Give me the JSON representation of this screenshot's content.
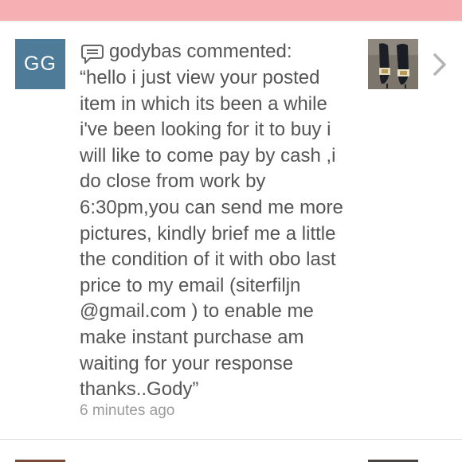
{
  "notification": {
    "avatar_initials": "GG",
    "username": "godybas",
    "action": "commented:",
    "comment_lines": [
      "“hello i just view your posted",
      "item in which its been a while",
      "i've been looking for it to buy i",
      "will like to come pay by cash ,i",
      "do close from work by",
      "6:30pm,you can send me more",
      "pictures, kindly brief me a little",
      "the condition of it with obo last",
      "price to my email (siterfiljn",
      "@gmail.com ) to enable me",
      "make instant purchase am",
      "waiting for your response",
      "thanks..Gody”"
    ],
    "time_ago": "6 minutes ago",
    "item_image_icon": "shoes-thumbnail",
    "chevron_icon": "chevron-right-icon"
  },
  "colors": {
    "top_bar": "#f6b0b4",
    "avatar_bg": "#4e7c98",
    "text": "#555555",
    "muted": "#9a9a9a"
  }
}
